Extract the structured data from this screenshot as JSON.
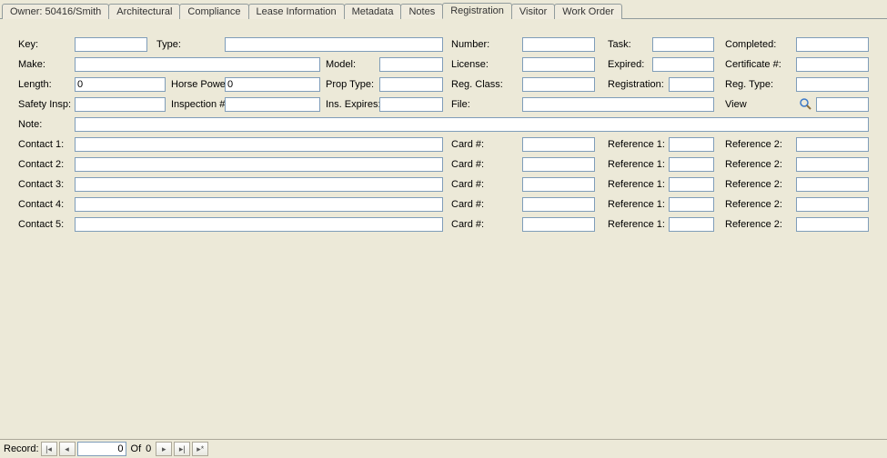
{
  "tabs": [
    {
      "label": "Owner:  50416/Smith"
    },
    {
      "label": "Architectural"
    },
    {
      "label": "Compliance"
    },
    {
      "label": "Lease Information"
    },
    {
      "label": "Metadata"
    },
    {
      "label": "Notes"
    },
    {
      "label": "Registration"
    },
    {
      "label": "Visitor"
    },
    {
      "label": "Work Order"
    }
  ],
  "labels": {
    "key": "Key:",
    "type": "Type:",
    "number": "Number:",
    "task": "Task:",
    "completed": "Completed:",
    "make": "Make:",
    "model": "Model:",
    "license": "License:",
    "expired": "Expired:",
    "certificate": "Certificate #:",
    "length": "Length:",
    "hp": "Horse Power:",
    "proptype": "Prop Type:",
    "regclass": "Reg. Class:",
    "registration": "Registration:",
    "regtype": "Reg. Type:",
    "safety": "Safety Insp:",
    "inspection": "Inspection #:",
    "insexp": "Ins. Expires:",
    "file": "File:",
    "view": "View",
    "note": "Note:",
    "contact1": "Contact 1:",
    "contact2": "Contact 2:",
    "contact3": "Contact 3:",
    "contact4": "Contact 4:",
    "contact5": "Contact 5:",
    "card": "Card #:",
    "ref1": "Reference 1:",
    "ref2": "Reference 2:"
  },
  "values": {
    "key": "",
    "type": "",
    "number": "",
    "task": "",
    "completed": "",
    "make": "",
    "model": "",
    "license": "",
    "expired": "",
    "certificate": "",
    "length": "0",
    "hp": "0",
    "proptype": "",
    "regclass": "",
    "registration": "",
    "regtype": "",
    "safety": "",
    "inspection": "",
    "insexp": "",
    "file": "",
    "note": "",
    "c1": "",
    "c1card": "",
    "c1ref1": "",
    "c1ref2": "",
    "c2": "",
    "c2card": "",
    "c2ref1": "",
    "c2ref2": "",
    "c3": "",
    "c3card": "",
    "c3ref1": "",
    "c3ref2": "",
    "c4": "",
    "c4card": "",
    "c4ref1": "",
    "c4ref2": "",
    "c5": "",
    "c5card": "",
    "c5ref1": "",
    "c5ref2": ""
  },
  "nav": {
    "record_label": "Record:",
    "current": "0",
    "of": "Of",
    "total": "0"
  }
}
